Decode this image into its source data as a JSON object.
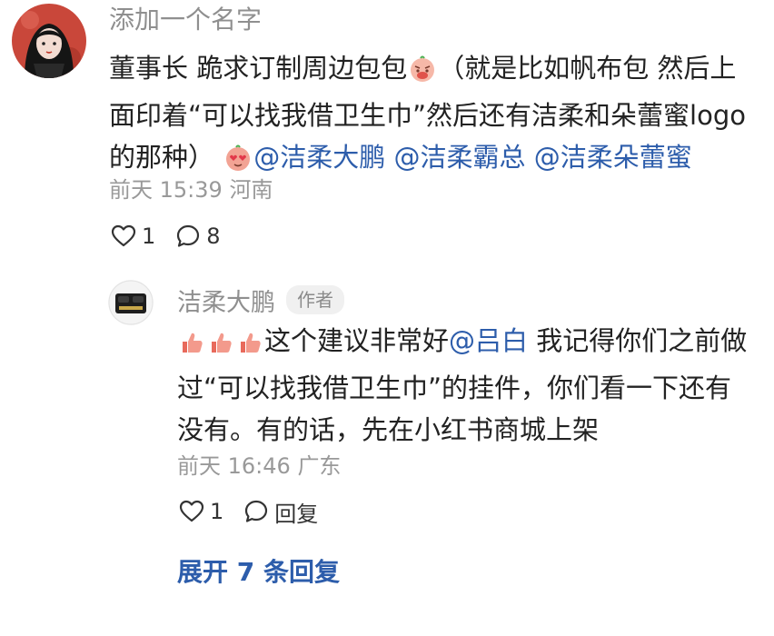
{
  "comment": {
    "username": "添加一个名字",
    "body_prefix": "董事长 跪求订制周边包包",
    "body_middle": "（就是比如帆布包 然后上面印着“可以找我借卫生巾”然后还有洁柔和朵蕾蜜logo的那种）",
    "mentions": [
      "@洁柔大鹏",
      "@洁柔霸总",
      "@洁柔朵蕾蜜"
    ],
    "time": "前天 15:39",
    "location": "河南",
    "likes": "1",
    "comments": "8",
    "emojis": [
      "pleading-face-emoji",
      "heart-eyes-emoji"
    ]
  },
  "reply": {
    "username": "洁柔大鹏",
    "author_tag": "作者",
    "body_before_mention": "这个建议非常好",
    "mention": "@吕白",
    "body_after_mention": " 我记得你们之前做过“可以找我借卫生巾”的挂件，你们看一下还有没有。有的话，先在小红书商城上架",
    "time": "前天 16:46",
    "location": "广东",
    "likes": "1",
    "reply_label": "回复",
    "emojis": [
      "thumbs-up-emoji",
      "thumbs-up-emoji",
      "thumbs-up-emoji"
    ]
  },
  "expand_label": "展开 7 条回复",
  "colors": {
    "mention": "#2d5dab",
    "meta": "#999999",
    "username": "#8f8f8f"
  }
}
